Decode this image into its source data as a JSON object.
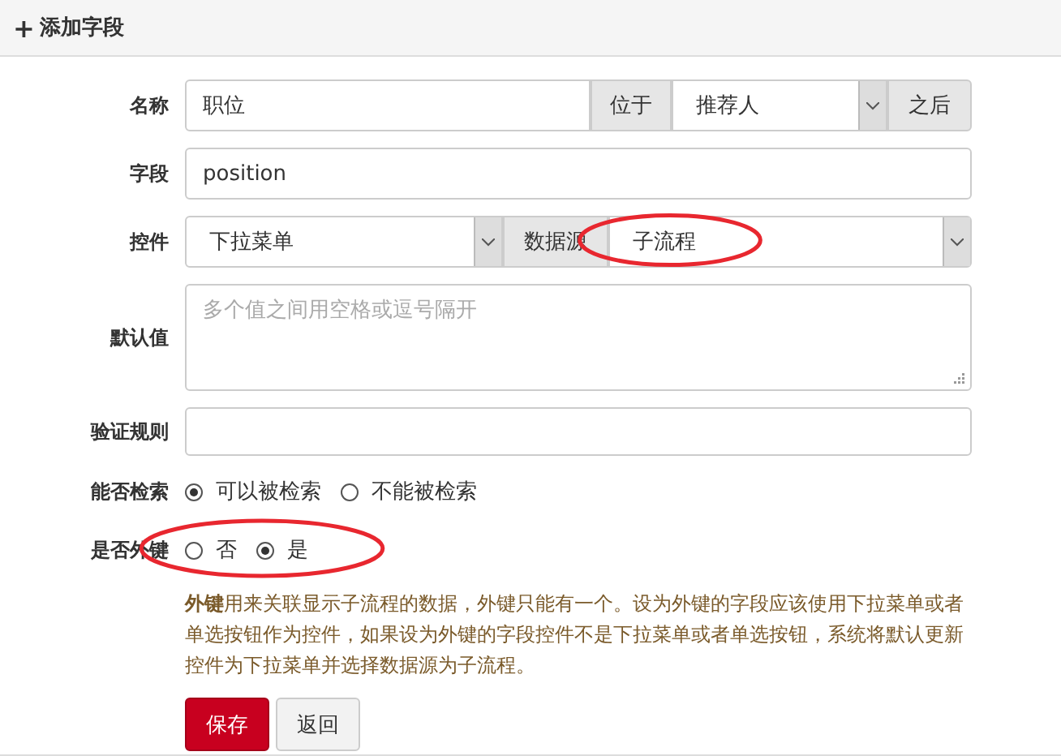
{
  "header": {
    "icon": "+",
    "title": "添加字段"
  },
  "name_row": {
    "label": "名称",
    "value": "职位",
    "position_label": "位于",
    "position_value": "推荐人",
    "after_label": "之后"
  },
  "field_row": {
    "label": "字段",
    "value": "position"
  },
  "control_row": {
    "label": "控件",
    "value": "下拉菜单",
    "source_label": "数据源",
    "source_value": "子流程",
    "circled": true
  },
  "default_row": {
    "label": "默认值",
    "placeholder": "多个值之间用空格或逗号隔开"
  },
  "validation_row": {
    "label": "验证规则"
  },
  "search_row": {
    "label": "能否检索",
    "options": [
      {
        "label": "可以被检索",
        "selected": true
      },
      {
        "label": "不能被检索",
        "selected": false
      }
    ]
  },
  "foreign_row": {
    "label": "是否外键",
    "circled": true,
    "options": [
      {
        "label": "否",
        "selected": false
      },
      {
        "label": "是",
        "selected": true
      }
    ]
  },
  "help": "**外键**用来关联显示子流程的数据，外键只能有一个。设为外键的字段应该使用下拉菜单或者单选按钮作为控件，如果设为外键的字段控件不是下拉菜单或者单选按钮，系统将默认更新控件为下拉菜单并选择数据源为子流程。",
  "buttons": [
    {
      "label": "保存",
      "kind": "primary"
    },
    {
      "label": "返回",
      "kind": "default"
    }
  ]
}
